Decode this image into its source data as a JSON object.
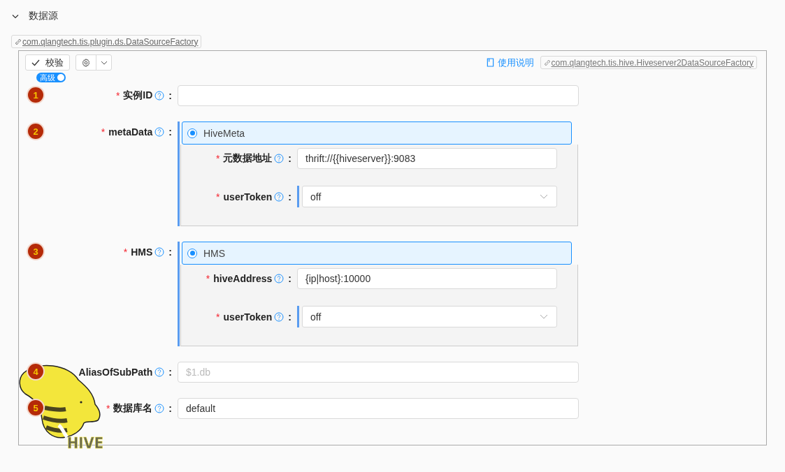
{
  "section": {
    "title": "数据源",
    "expanded": true
  },
  "plugin_tag": "com.qlangtech.tis.plugin.ds.DataSourceFactory",
  "toolbar": {
    "validate_button": "校验",
    "help_link": "使用说明",
    "impl_tag": "com.qlangtech.tis.hive.Hiveserver2DataSourceFactory"
  },
  "advanced_toggle": {
    "label": "高级",
    "on": true
  },
  "fields": [
    {
      "kind": "input",
      "number": "1",
      "required_mark": "*",
      "label": "实例ID",
      "colon": ":"
    },
    {
      "kind": "group",
      "number": "2",
      "required_mark": "*",
      "label": "metaData",
      "colon": ":",
      "option": {
        "label": "HiveMeta",
        "selected": true
      },
      "fields": [
        {
          "kind": "input",
          "required_mark": "*",
          "label": "元数据地址",
          "colon": ":",
          "value": "thrift://{{hiveserver}}:9083"
        },
        {
          "kind": "select",
          "required_mark": "*",
          "label": "userToken",
          "colon": ":",
          "value": "off"
        }
      ]
    },
    {
      "kind": "group",
      "number": "3",
      "required_mark": "*",
      "label": "HMS",
      "colon": ":",
      "option": {
        "label": "HMS",
        "selected": true
      },
      "fields": [
        {
          "kind": "input",
          "required_mark": "*",
          "label": "hiveAddress",
          "colon": ":",
          "value": "{ip|host}:10000"
        },
        {
          "kind": "select",
          "required_mark": "*",
          "label": "userToken",
          "colon": ":",
          "value": "off"
        }
      ]
    },
    {
      "kind": "input",
      "number": "4",
      "label": "AliasOfSubPath",
      "colon": ":",
      "placeholder": "$1.db"
    },
    {
      "kind": "input",
      "number": "5",
      "required_mark": "*",
      "label": "数据库名",
      "colon": ":",
      "value": "default"
    }
  ],
  "logo": {
    "text": "HIVE"
  }
}
